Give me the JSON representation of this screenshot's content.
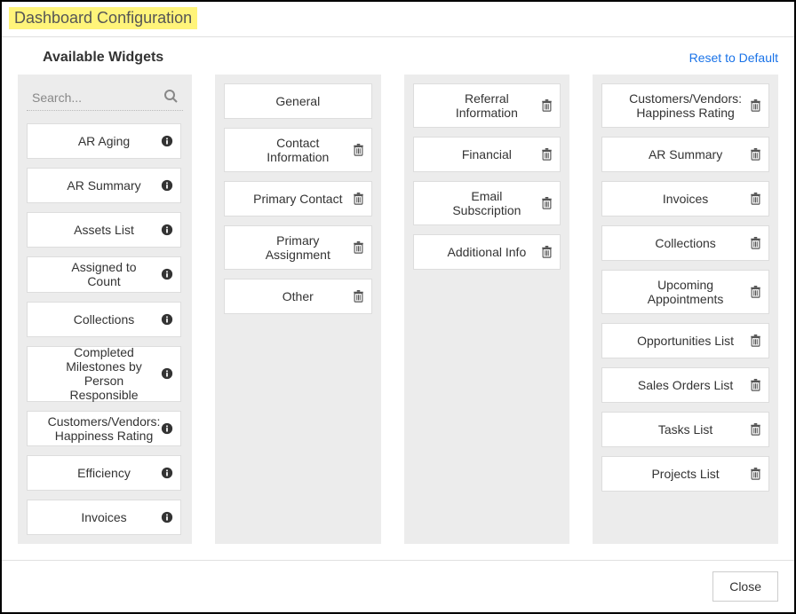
{
  "title": "Dashboard Configuration",
  "header": {
    "available_label": "Available Widgets",
    "reset_label": "Reset to Default"
  },
  "search": {
    "placeholder": "Search..."
  },
  "available_widgets": [
    "AR Aging",
    "AR Summary",
    "Assets List",
    "Assigned to Count",
    "Collections",
    "Completed Milestones by Person Responsible",
    "Customers/Vendors: Happiness Rating",
    "Efficiency",
    "Invoices"
  ],
  "column2": [
    "General",
    "Contact Information",
    "Primary Contact",
    "Primary Assignment",
    "Other"
  ],
  "column3": [
    "Referral Information",
    "Financial",
    "Email Subscription",
    "Additional Info"
  ],
  "column4": [
    "Customers/Vendors: Happiness Rating",
    "AR Summary",
    "Invoices",
    "Collections",
    "Upcoming Appointments",
    "Opportunities List",
    "Sales Orders List",
    "Tasks List",
    "Projects List"
  ],
  "footer": {
    "close_label": "Close"
  }
}
